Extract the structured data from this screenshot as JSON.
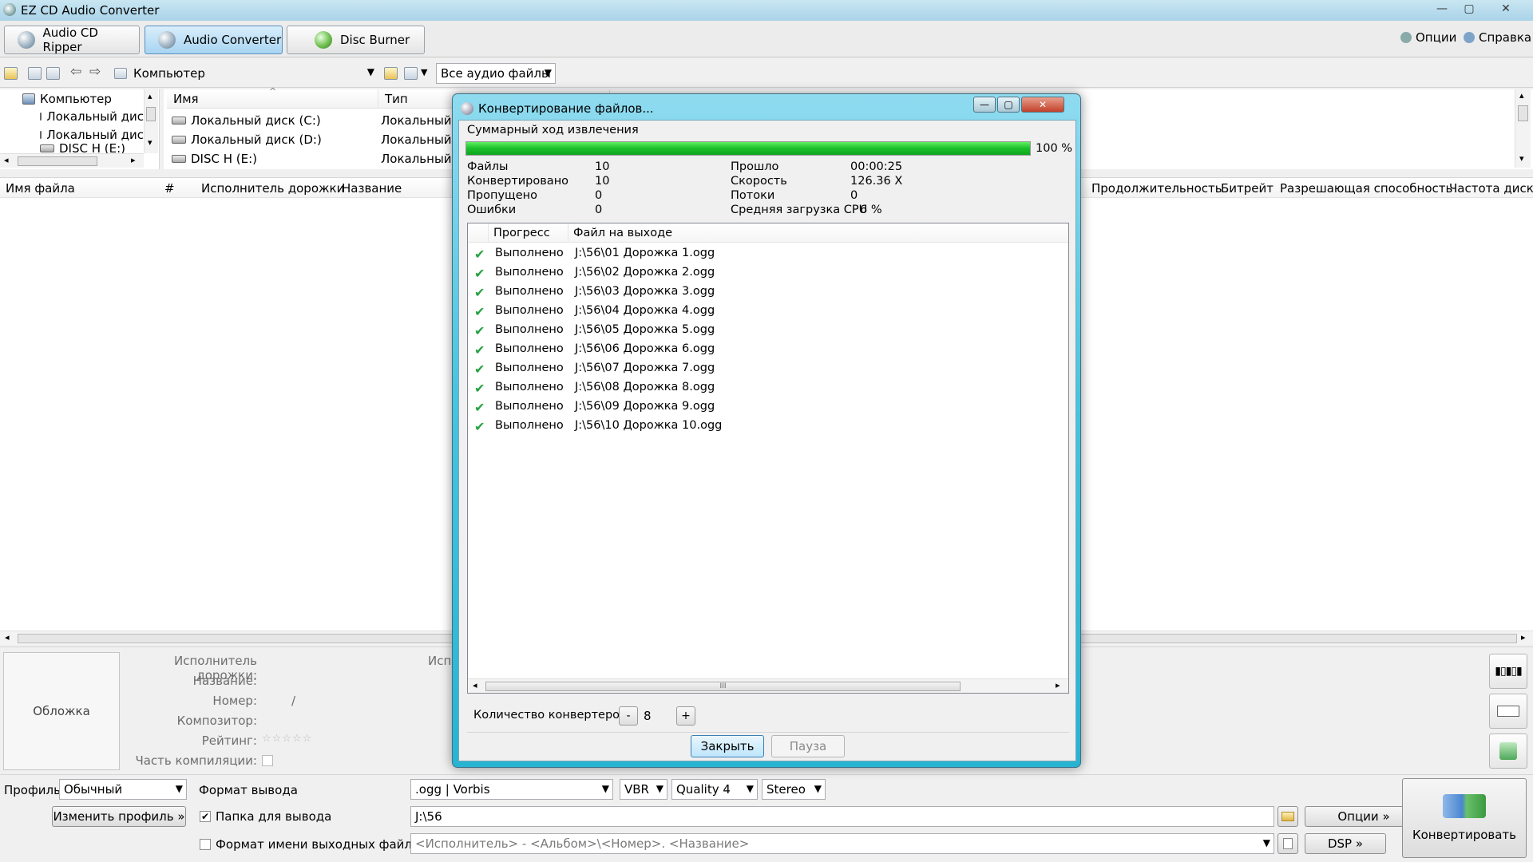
{
  "window": {
    "title": "EZ CD Audio Converter"
  },
  "tabs": [
    {
      "label": "Audio CD Ripper"
    },
    {
      "label": "Audio Converter"
    },
    {
      "label": "Disc Burner"
    }
  ],
  "top_links": {
    "options": "Опции",
    "help": "Справка"
  },
  "address": {
    "location": "Компьютер",
    "filter": "Все аудио файлы"
  },
  "tree": {
    "items": [
      "Компьютер",
      "Локальный дис",
      "Локальный дис",
      "DISC H (E:)"
    ]
  },
  "browser": {
    "columns": [
      "Имя",
      "Тип"
    ],
    "rows": [
      {
        "name": "Локальный диск (C:)",
        "type": "Локальный д"
      },
      {
        "name": "Локальный диск (D:)",
        "type": "Локальный д"
      },
      {
        "name": "DISC H (E:)",
        "type": "Локальный д"
      }
    ]
  },
  "track_columns": {
    "left": [
      "Имя файла",
      "#",
      "Исполнитель дорожки",
      "Название"
    ],
    "right": [
      "Продолжительность",
      "Битрейт",
      "Разрешающая способность",
      "Частота дискре"
    ]
  },
  "metadata": {
    "cover": "Обложка",
    "labels": [
      "Исполнитель дорожки:",
      "Название:",
      "Номер:",
      "Композитор:",
      "Рейтинг:",
      "Часть компиляции:"
    ],
    "number_sep": "/",
    "rating_stars": "☆☆☆☆☆",
    "artist2_label": "Исп"
  },
  "profile": {
    "label": "Профиль",
    "value": "Обычный",
    "change_button": "Изменить профиль »",
    "format_label": "Формат вывода",
    "format_value": ".ogg | Vorbis",
    "mode": "VBR",
    "quality": "Quality 4",
    "channels": "Stereo",
    "output_folder_label": "Папка для вывода",
    "output_folder_checked": true,
    "output_folder": "J:\\56",
    "filename_format_label": "Формат имени выходных файлов",
    "filename_format_checked": false,
    "filename_format": "<Исполнитель> - <Альбом>\\<Номер>. <Название>",
    "options_button": "Опции »",
    "dsp_button": "DSP »",
    "convert_button": "Конвертировать"
  },
  "dialog": {
    "title": "Конвертирование файлов...",
    "overall_label": "Суммарный ход извлечения",
    "progress_percent": "100 %",
    "progress_value": 1.0,
    "stats_left": [
      {
        "label": "Файлы",
        "value": "10"
      },
      {
        "label": "Конвертировано",
        "value": "10"
      },
      {
        "label": "Пропущено",
        "value": "0"
      },
      {
        "label": "Ошибки",
        "value": "0"
      }
    ],
    "stats_right": [
      {
        "label": "Прошло",
        "value": "00:00:25"
      },
      {
        "label": "Скорость",
        "value": "126.36 X"
      },
      {
        "label": "Потоки",
        "value": "0"
      },
      {
        "label": "Средняя загрузка CPU",
        "value": "6 %"
      }
    ],
    "columns": [
      "Прогресс",
      "Файл на выходе"
    ],
    "jobs": [
      {
        "status": "Выполнено",
        "file": "J:\\56\\01 Дорожка 1.ogg"
      },
      {
        "status": "Выполнено",
        "file": "J:\\56\\02 Дорожка 2.ogg"
      },
      {
        "status": "Выполнено",
        "file": "J:\\56\\03 Дорожка 3.ogg"
      },
      {
        "status": "Выполнено",
        "file": "J:\\56\\04 Дорожка 4.ogg"
      },
      {
        "status": "Выполнено",
        "file": "J:\\56\\05 Дорожка 5.ogg"
      },
      {
        "status": "Выполнено",
        "file": "J:\\56\\06 Дорожка 6.ogg"
      },
      {
        "status": "Выполнено",
        "file": "J:\\56\\07 Дорожка 7.ogg"
      },
      {
        "status": "Выполнено",
        "file": "J:\\56\\08 Дорожка 8.ogg"
      },
      {
        "status": "Выполнено",
        "file": "J:\\56\\09 Дорожка 9.ogg"
      },
      {
        "status": "Выполнено",
        "file": "J:\\56\\10 Дорожка 10.ogg"
      }
    ],
    "converter_count_label": "Количество конвертеров:",
    "converter_count": "8",
    "minus": "-",
    "plus": "+",
    "close_button": "Закрыть",
    "pause_button": "Пауза",
    "scroll_grip": "III"
  },
  "icons": {
    "check": "✔",
    "dropdown": "▼",
    "back": "⇦",
    "forward": "⇨",
    "minimize": "—",
    "maximize": "▢",
    "close": "✕",
    "scroll_left": "◂",
    "scroll_right": "▸",
    "scroll_up": "▴",
    "scroll_down": "▾",
    "sort": "^"
  },
  "colors": {
    "dialog_frame": "#3fc2dc",
    "progress": "#1bbf2b",
    "check": "#25a244"
  }
}
